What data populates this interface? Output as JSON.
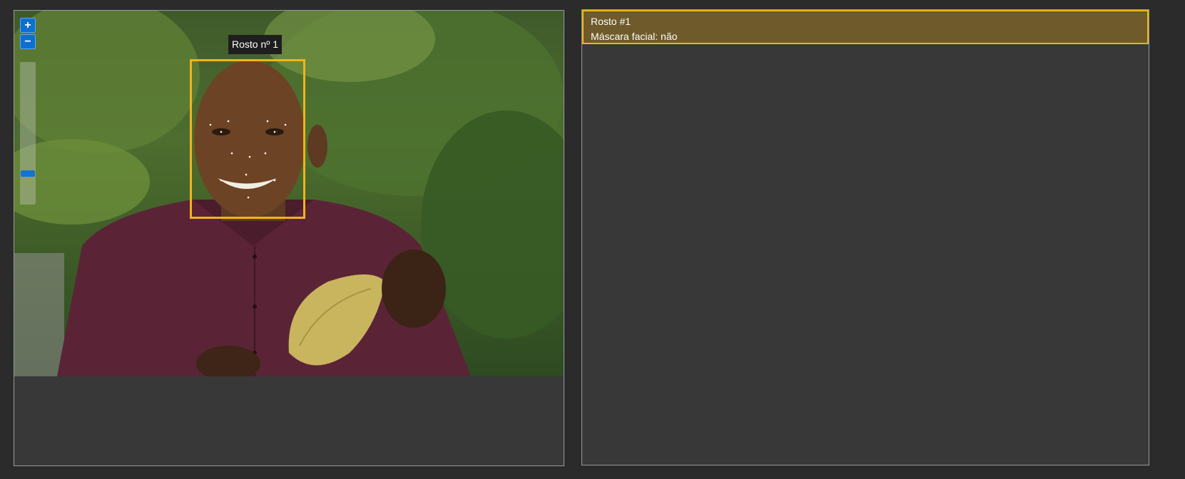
{
  "image_viewer": {
    "zoom_in_label": "+",
    "zoom_out_label": "−",
    "zoom_level": 0.15,
    "face_tooltip": "Rosto nº 1",
    "colors": {
      "face_box": "#f0b419",
      "zoom_button": "#0d6fd1"
    },
    "icons": {
      "zoom_in": "plus-icon",
      "zoom_out": "minus-icon"
    }
  },
  "results": {
    "items": [
      {
        "title": "Rosto #1",
        "mask_label": "Máscara facial: não"
      }
    ],
    "colors": {
      "selected_bg": "#6e5a2a",
      "selected_border": "#f0b419"
    }
  }
}
